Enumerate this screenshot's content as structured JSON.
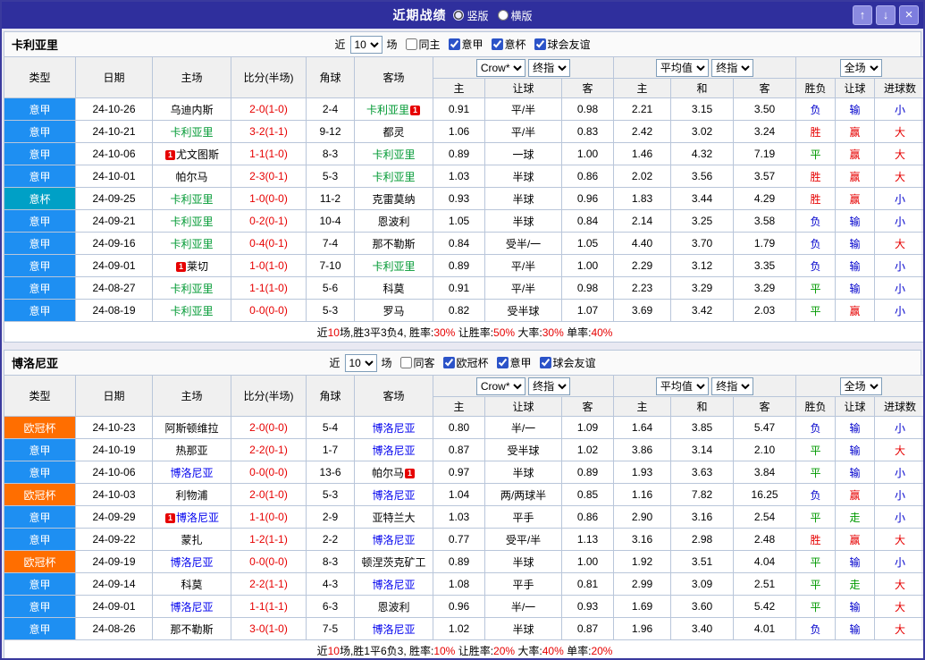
{
  "titlebar": {
    "title": "近期战绩",
    "radios": [
      {
        "label": "竖版",
        "selected": true
      },
      {
        "label": "横版",
        "selected": false
      }
    ],
    "buttons": {
      "up": "↑",
      "down": "↓",
      "close": "×"
    }
  },
  "columns": [
    "类型",
    "日期",
    "主场",
    "比分(半场)",
    "角球",
    "客场",
    "主",
    "让球",
    "客",
    "主",
    "和",
    "客",
    "胜负",
    "让球",
    "进球数"
  ],
  "colors": {
    "red": "#e60000",
    "green": "#009900",
    "blue": "#0000cc",
    "titlebar_bg": "#2f2f9d",
    "border": "#b9c6da",
    "header_bg": "#f0f0f0"
  },
  "league_colors": {
    "意甲": "#1e8ff2",
    "意杯": "#00a0c6",
    "欧冠杯": "#ff6e00"
  },
  "outcome_colors": {
    "胜": "#e60000",
    "赢": "#e60000",
    "大": "#e60000",
    "平": "#009900",
    "走": "#009900",
    "负": "#0000cc",
    "输": "#0000cc",
    "小": "#0000cc"
  },
  "tables": [
    {
      "team": "卡利亚里",
      "focus_color": "#009933",
      "controls": {
        "near_label": "近",
        "count": "10",
        "matches_label": "场"
      },
      "filters": [
        {
          "label": "同主",
          "checked": false
        },
        {
          "label": "意甲",
          "checked": true
        },
        {
          "label": "意杯",
          "checked": true
        },
        {
          "label": "球会友谊",
          "checked": true
        }
      ],
      "dropdowns": {
        "source": "Crow*",
        "time": "终指",
        "avg": "平均值",
        "avg_time": "终指",
        "scope": "全场"
      },
      "rows": [
        {
          "league": "意甲",
          "date": "24-10-26",
          "home": {
            "name": "乌迪内斯"
          },
          "score": "2-0(1-0)",
          "corners": "2-4",
          "away": {
            "name": "卡利亚里",
            "focus": true,
            "badge": "1",
            "badge_pos": "right"
          },
          "instant": [
            "0.91",
            "平/半",
            "0.98"
          ],
          "average": [
            "2.21",
            "3.15",
            "3.50"
          ],
          "result": "负",
          "handicap_result": "输",
          "goals": "小"
        },
        {
          "league": "意甲",
          "date": "24-10-21",
          "home": {
            "name": "卡利亚里",
            "focus": true
          },
          "score": "3-2(1-1)",
          "corners": "9-12",
          "away": {
            "name": "都灵"
          },
          "instant": [
            "1.06",
            "平/半",
            "0.83"
          ],
          "average": [
            "2.42",
            "3.02",
            "3.24"
          ],
          "result": "胜",
          "handicap_result": "赢",
          "goals": "大"
        },
        {
          "league": "意甲",
          "date": "24-10-06",
          "home": {
            "name": "尤文图斯",
            "badge": "1",
            "badge_pos": "left"
          },
          "score": "1-1(1-0)",
          "corners": "8-3",
          "away": {
            "name": "卡利亚里",
            "focus": true
          },
          "instant": [
            "0.89",
            "一球",
            "1.00"
          ],
          "average": [
            "1.46",
            "4.32",
            "7.19"
          ],
          "result": "平",
          "handicap_result": "赢",
          "goals": "大"
        },
        {
          "league": "意甲",
          "date": "24-10-01",
          "home": {
            "name": "帕尔马"
          },
          "score": "2-3(0-1)",
          "corners": "5-3",
          "away": {
            "name": "卡利亚里",
            "focus": true
          },
          "instant": [
            "1.03",
            "半球",
            "0.86"
          ],
          "average": [
            "2.02",
            "3.56",
            "3.57"
          ],
          "result": "胜",
          "handicap_result": "赢",
          "goals": "大"
        },
        {
          "league": "意杯",
          "date": "24-09-25",
          "home": {
            "name": "卡利亚里",
            "focus": true
          },
          "score": "1-0(0-0)",
          "corners": "11-2",
          "away": {
            "name": "克雷莫纳"
          },
          "instant": [
            "0.93",
            "半球",
            "0.96"
          ],
          "average": [
            "1.83",
            "3.44",
            "4.29"
          ],
          "result": "胜",
          "handicap_result": "赢",
          "goals": "小"
        },
        {
          "league": "意甲",
          "date": "24-09-21",
          "home": {
            "name": "卡利亚里",
            "focus": true
          },
          "score": "0-2(0-1)",
          "corners": "10-4",
          "away": {
            "name": "恩波利"
          },
          "instant": [
            "1.05",
            "半球",
            "0.84"
          ],
          "average": [
            "2.14",
            "3.25",
            "3.58"
          ],
          "result": "负",
          "handicap_result": "输",
          "goals": "小"
        },
        {
          "league": "意甲",
          "date": "24-09-16",
          "home": {
            "name": "卡利亚里",
            "focus": true
          },
          "score": "0-4(0-1)",
          "corners": "7-4",
          "away": {
            "name": "那不勒斯"
          },
          "instant": [
            "0.84",
            "受半/一",
            "1.05"
          ],
          "average": [
            "4.40",
            "3.70",
            "1.79"
          ],
          "result": "负",
          "handicap_result": "输",
          "goals": "大"
        },
        {
          "league": "意甲",
          "date": "24-09-01",
          "home": {
            "name": "莱切",
            "badge": "1",
            "badge_pos": "left"
          },
          "score": "1-0(1-0)",
          "corners": "7-10",
          "away": {
            "name": "卡利亚里",
            "focus": true
          },
          "instant": [
            "0.89",
            "平/半",
            "1.00"
          ],
          "average": [
            "2.29",
            "3.12",
            "3.35"
          ],
          "result": "负",
          "handicap_result": "输",
          "goals": "小"
        },
        {
          "league": "意甲",
          "date": "24-08-27",
          "home": {
            "name": "卡利亚里",
            "focus": true
          },
          "score": "1-1(1-0)",
          "corners": "5-6",
          "away": {
            "name": "科莫"
          },
          "instant": [
            "0.91",
            "平/半",
            "0.98"
          ],
          "average": [
            "2.23",
            "3.29",
            "3.29"
          ],
          "result": "平",
          "handicap_result": "输",
          "goals": "小"
        },
        {
          "league": "意甲",
          "date": "24-08-19",
          "home": {
            "name": "卡利亚里",
            "focus": true
          },
          "score": "0-0(0-0)",
          "corners": "5-3",
          "away": {
            "name": "罗马"
          },
          "instant": [
            "0.82",
            "受半球",
            "1.07"
          ],
          "average": [
            "3.69",
            "3.42",
            "2.03"
          ],
          "result": "平",
          "handicap_result": "赢",
          "goals": "小"
        }
      ],
      "footer": [
        {
          "text": "近"
        },
        {
          "text": "10",
          "red": true
        },
        {
          "text": "场,胜3平3负4, 胜率:"
        },
        {
          "text": "30%",
          "red": true
        },
        {
          "text": " 让胜率:"
        },
        {
          "text": "50%",
          "red": true
        },
        {
          "text": " 大率:"
        },
        {
          "text": "30%",
          "red": true
        },
        {
          "text": " 单率:"
        },
        {
          "text": "40%",
          "red": true
        }
      ]
    },
    {
      "team": "博洛尼亚",
      "focus_color": "#0000ee",
      "controls": {
        "near_label": "近",
        "count": "10",
        "matches_label": "场"
      },
      "filters": [
        {
          "label": "同客",
          "checked": false
        },
        {
          "label": "欧冠杯",
          "checked": true
        },
        {
          "label": "意甲",
          "checked": true
        },
        {
          "label": "球会友谊",
          "checked": true
        }
      ],
      "dropdowns": {
        "source": "Crow*",
        "time": "终指",
        "avg": "平均值",
        "avg_time": "终指",
        "scope": "全场"
      },
      "rows": [
        {
          "league": "欧冠杯",
          "date": "24-10-23",
          "home": {
            "name": "阿斯顿维拉"
          },
          "score": "2-0(0-0)",
          "corners": "5-4",
          "away": {
            "name": "博洛尼亚",
            "focus": true
          },
          "instant": [
            "0.80",
            "半/一",
            "1.09"
          ],
          "average": [
            "1.64",
            "3.85",
            "5.47"
          ],
          "result": "负",
          "handicap_result": "输",
          "goals": "小"
        },
        {
          "league": "意甲",
          "date": "24-10-19",
          "home": {
            "name": "热那亚"
          },
          "score": "2-2(0-1)",
          "corners": "1-7",
          "away": {
            "name": "博洛尼亚",
            "focus": true
          },
          "instant": [
            "0.87",
            "受半球",
            "1.02"
          ],
          "average": [
            "3.86",
            "3.14",
            "2.10"
          ],
          "result": "平",
          "handicap_result": "输",
          "goals": "大"
        },
        {
          "league": "意甲",
          "date": "24-10-06",
          "home": {
            "name": "博洛尼亚",
            "focus": true
          },
          "score": "0-0(0-0)",
          "corners": "13-6",
          "away": {
            "name": "帕尔马",
            "badge": "1",
            "badge_pos": "right"
          },
          "instant": [
            "0.97",
            "半球",
            "0.89"
          ],
          "average": [
            "1.93",
            "3.63",
            "3.84"
          ],
          "result": "平",
          "handicap_result": "输",
          "goals": "小"
        },
        {
          "league": "欧冠杯",
          "date": "24-10-03",
          "home": {
            "name": "利物浦"
          },
          "score": "2-0(1-0)",
          "corners": "5-3",
          "away": {
            "name": "博洛尼亚",
            "focus": true
          },
          "instant": [
            "1.04",
            "两/两球半",
            "0.85"
          ],
          "average": [
            "1.16",
            "7.82",
            "16.25"
          ],
          "result": "负",
          "handicap_result": "赢",
          "goals": "小"
        },
        {
          "league": "意甲",
          "date": "24-09-29",
          "home": {
            "name": "博洛尼亚",
            "focus": true,
            "badge": "1",
            "badge_pos": "left"
          },
          "score": "1-1(0-0)",
          "corners": "2-9",
          "away": {
            "name": "亚特兰大"
          },
          "instant": [
            "1.03",
            "平手",
            "0.86"
          ],
          "average": [
            "2.90",
            "3.16",
            "2.54"
          ],
          "result": "平",
          "handicap_result": "走",
          "goals": "小"
        },
        {
          "league": "意甲",
          "date": "24-09-22",
          "home": {
            "name": "蒙扎"
          },
          "score": "1-2(1-1)",
          "corners": "2-2",
          "away": {
            "name": "博洛尼亚",
            "focus": true
          },
          "instant": [
            "0.77",
            "受平/半",
            "1.13"
          ],
          "average": [
            "3.16",
            "2.98",
            "2.48"
          ],
          "result": "胜",
          "handicap_result": "赢",
          "goals": "大"
        },
        {
          "league": "欧冠杯",
          "date": "24-09-19",
          "home": {
            "name": "博洛尼亚",
            "focus": true
          },
          "score": "0-0(0-0)",
          "corners": "8-3",
          "away": {
            "name": "顿涅茨克矿工"
          },
          "instant": [
            "0.89",
            "半球",
            "1.00"
          ],
          "average": [
            "1.92",
            "3.51",
            "4.04"
          ],
          "result": "平",
          "handicap_result": "输",
          "goals": "小"
        },
        {
          "league": "意甲",
          "date": "24-09-14",
          "home": {
            "name": "科莫"
          },
          "score": "2-2(1-1)",
          "corners": "4-3",
          "away": {
            "name": "博洛尼亚",
            "focus": true
          },
          "instant": [
            "1.08",
            "平手",
            "0.81"
          ],
          "average": [
            "2.99",
            "3.09",
            "2.51"
          ],
          "result": "平",
          "handicap_result": "走",
          "goals": "大"
        },
        {
          "league": "意甲",
          "date": "24-09-01",
          "home": {
            "name": "博洛尼亚",
            "focus": true
          },
          "score": "1-1(1-1)",
          "corners": "6-3",
          "away": {
            "name": "恩波利"
          },
          "instant": [
            "0.96",
            "半/一",
            "0.93"
          ],
          "average": [
            "1.69",
            "3.60",
            "5.42"
          ],
          "result": "平",
          "handicap_result": "输",
          "goals": "大"
        },
        {
          "league": "意甲",
          "date": "24-08-26",
          "home": {
            "name": "那不勒斯"
          },
          "score": "3-0(1-0)",
          "corners": "7-5",
          "away": {
            "name": "博洛尼亚",
            "focus": true
          },
          "instant": [
            "1.02",
            "半球",
            "0.87"
          ],
          "average": [
            "1.96",
            "3.40",
            "4.01"
          ],
          "result": "负",
          "handicap_result": "输",
          "goals": "大"
        }
      ],
      "footer": [
        {
          "text": "近"
        },
        {
          "text": "10",
          "red": true
        },
        {
          "text": "场,胜1平6负3, 胜率:"
        },
        {
          "text": "10%",
          "red": true
        },
        {
          "text": " 让胜率:"
        },
        {
          "text": "20%",
          "red": true
        },
        {
          "text": " 大率:"
        },
        {
          "text": "40%",
          "red": true
        },
        {
          "text": " 单率:"
        },
        {
          "text": "20%",
          "red": true
        }
      ]
    }
  ]
}
